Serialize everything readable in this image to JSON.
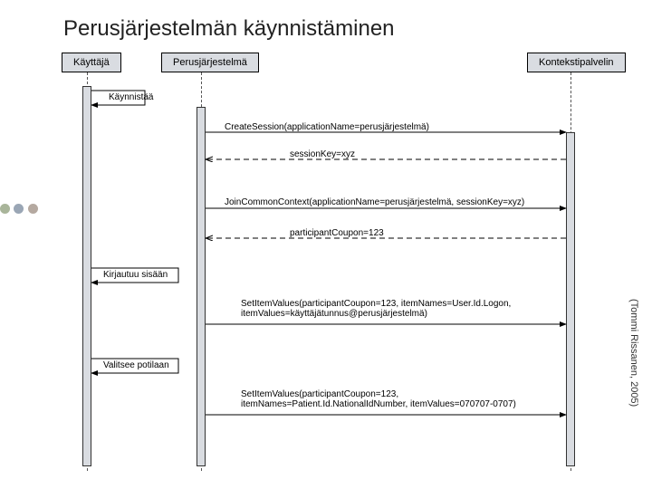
{
  "title": "Perusjärjestelmän käynnistäminen",
  "participants": {
    "user": "Käyttäjä",
    "system": "Perusjärjestelmä",
    "context": "Kontekstipalvelin"
  },
  "messages": {
    "m1": "Käynnistää",
    "m2": "CreateSession(applicationName=perusjärjestelmä)",
    "m3": "sessionKey=xyz",
    "m4": "JoinCommonContext(applicationName=perusjärjestelmä, sessionKey=xyz)",
    "m5": "participantCoupon=123",
    "m6": "Kirjautuu sisään",
    "m7": "SetItemValues(participantCoupon=123, itemNames=User.Id.Logon, itemValues=käyttäjätunnus@perusjärjestelmä)",
    "m8": "Valitsee potilaan",
    "m9": "SetItemValues(participantCoupon=123, itemNames=Patient.Id.NationalIdNumber, itemValues=070707-0707)"
  },
  "credit": "(Tommi Rissanen, 2005)",
  "decor_colors": [
    "#a9b59a",
    "#9aa6b5",
    "#b5a9a0"
  ]
}
